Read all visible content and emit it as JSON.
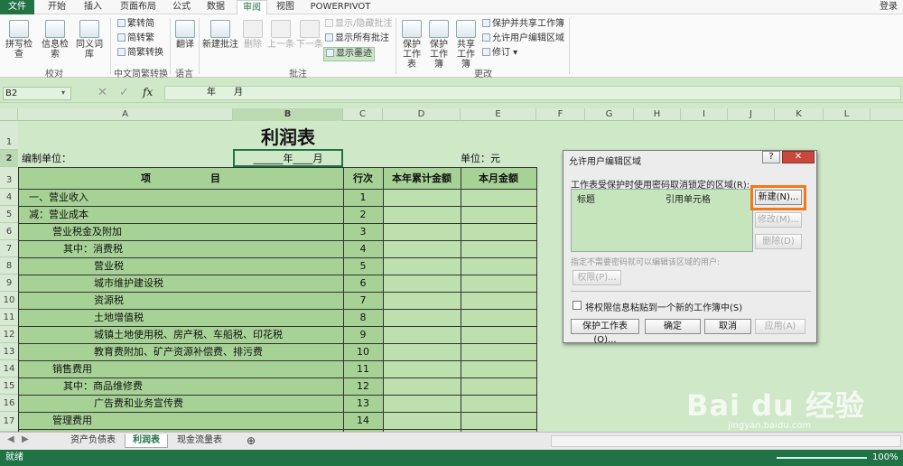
{
  "ribbon_tabs": [
    "文件",
    "开始",
    "插入",
    "页面布局",
    "公式",
    "数据",
    "审阅",
    "视图",
    "POWERPIVOT"
  ],
  "account": "登录",
  "ribbon": {
    "spell": "拼写检查",
    "research": "信息检索",
    "thesaurus": "同义词库",
    "proof_group": "校对",
    "trad": "繁转简",
    "simp": "简转繁",
    "conv": "简繁转换",
    "chinese_group": "中文简繁转换",
    "translate": "翻译",
    "lang_group": "语言",
    "new_comment": "新建批注",
    "delete": "删除",
    "prev": "上一条",
    "next": "下一条",
    "show_hide": "显示/隐藏批注",
    "show_all": "显示所有批注",
    "show_ink": "显示墨迹",
    "comment_group": "批注",
    "protect_sheet": "保护工作表",
    "protect_book": "保护工作簿",
    "share_book": "共享工作簿",
    "protect_share": "保护并共享工作簿",
    "allow_edit": "允许用户编辑区域",
    "track": "修订",
    "changes_group": "更改"
  },
  "formula": {
    "name": "B2",
    "fx": "fx",
    "content": "年　　月"
  },
  "columns": [
    "A",
    "B",
    "C",
    "D",
    "E",
    "F",
    "G",
    "H",
    "I",
    "J",
    "K",
    "L"
  ],
  "sheet": {
    "title": "利润表",
    "unit_left": "编制单位：",
    "period": "______年____月",
    "unit_right": "单位：元",
    "headers": [
      "项　　　　　　目",
      "行次",
      "本年累计金额",
      "本月金额"
    ],
    "rows": [
      {
        "item": "一、营业收入",
        "n": "1"
      },
      {
        "item": "减：营业成本",
        "n": "2"
      },
      {
        "item": "营业税金及附加",
        "n": "3"
      },
      {
        "item": "其中：消费税",
        "n": "4"
      },
      {
        "item": "营业税",
        "n": "5"
      },
      {
        "item": "城市维护建设税",
        "n": "6"
      },
      {
        "item": "资源税",
        "n": "7"
      },
      {
        "item": "土地增值税",
        "n": "8"
      },
      {
        "item": "城镇土地使用税、房产税、车船税、印花税",
        "n": "9"
      },
      {
        "item": "教育费附加、矿产资源补偿费、排污费",
        "n": "10"
      },
      {
        "item": "销售费用",
        "n": "11"
      },
      {
        "item": "其中：商品维修费",
        "n": "12"
      },
      {
        "item": "广告费和业务宣传费",
        "n": "13"
      },
      {
        "item": "管理费用",
        "n": "14"
      }
    ],
    "row_numbers": [
      "1",
      "2",
      "3",
      "4",
      "5",
      "6",
      "7",
      "8",
      "9",
      "10",
      "11",
      "12",
      "13",
      "14",
      "15",
      "16",
      "17"
    ]
  },
  "dialog": {
    "title": "允许用户编辑区域",
    "help": "?",
    "close": "✕",
    "intro": "工作表受保护时使用密码取消锁定的区域(R):",
    "col1": "标题",
    "col2": "引用单元格",
    "new": "新建(N)...",
    "modify": "修改(M)...",
    "delete": "删除(D)",
    "perm_label": "指定不需要密码就可以编辑该区域的用户:",
    "perm": "权限(P)...",
    "paste_check": "将权限信息粘贴到一个新的工作簿中(S)",
    "protect": "保护工作表(O)...",
    "ok": "确定",
    "cancel": "取消",
    "apply": "应用(A)"
  },
  "sheet_tabs": [
    "资产负债表",
    "利润表",
    "现金流量表"
  ],
  "add_sheet": "⊕",
  "status": {
    "ready": "就绪",
    "zoom": "100%"
  },
  "watermark": {
    "brand": "Bai du 经验",
    "url": "jingyan.baidu.com"
  },
  "colors": {
    "excel_green": "#217346",
    "cell_green": "#a7d296",
    "highlight": "#f07a1a"
  }
}
